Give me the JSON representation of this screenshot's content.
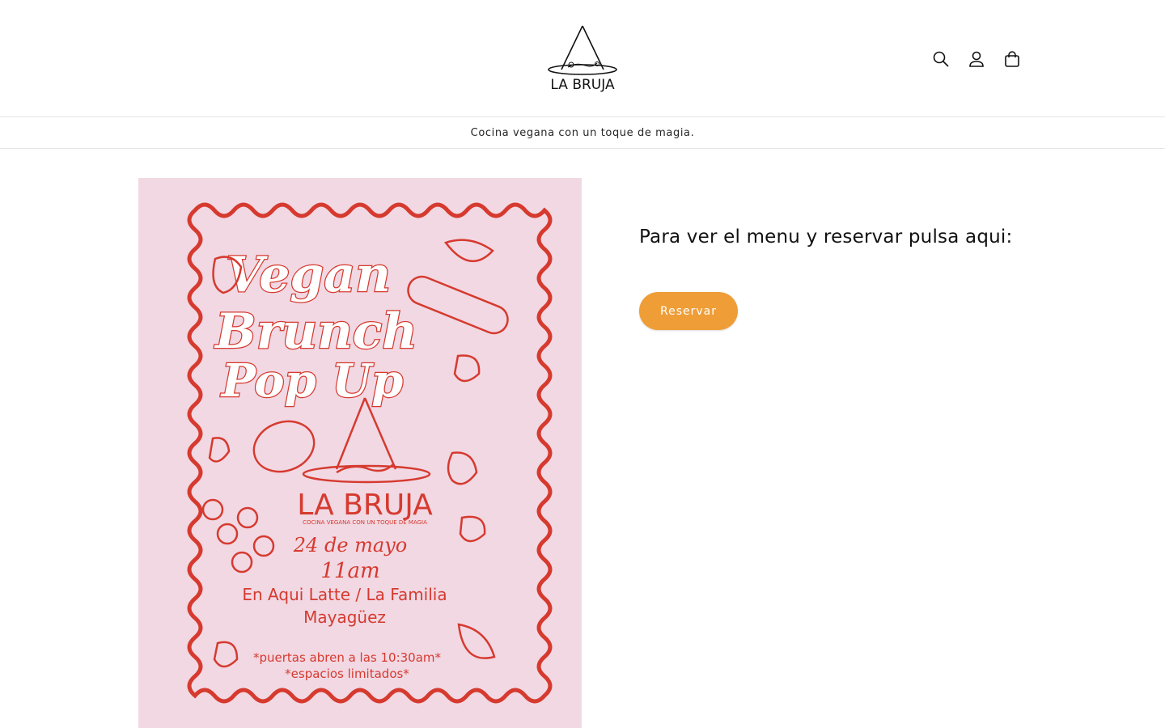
{
  "brand": {
    "logo_text": "LA BRUJA"
  },
  "header": {
    "icons": [
      "search-icon",
      "account-icon",
      "cart-icon"
    ]
  },
  "announcement": {
    "text": "Cocina vegana con un toque de magia."
  },
  "poster": {
    "title_lines": [
      "Vegan",
      "Brunch",
      "Pop Up"
    ],
    "brand": "LA BRUJA",
    "tagline": "COCINA VEGANA CON UN TOQUE DE MAGIA",
    "date": "24 de mayo",
    "time": "11am",
    "location_line1": "En Aqui Latte / La Familia",
    "location_line2": "Mayagüez",
    "note1": "*puertas abren a las 10:30am*",
    "note2": "*espacios limitados*"
  },
  "promo": {
    "text": "Para ver el menu y reservar pulsa aqui:",
    "button_label": "Reservar"
  },
  "colors": {
    "accent": "#ef9d37",
    "poster_bg": "#f1d8e3",
    "poster_red": "#d63a2f"
  }
}
